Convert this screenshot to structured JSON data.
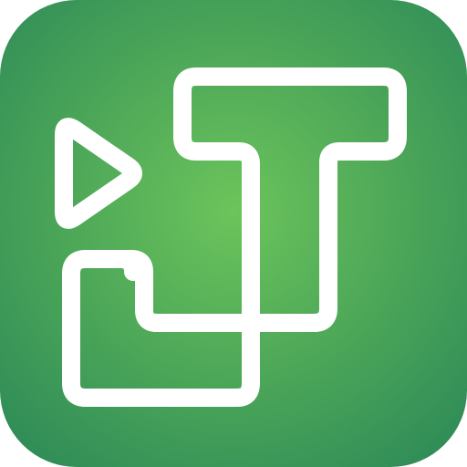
{
  "icon": {
    "name": "app-logo-icon",
    "glyphs": [
      "play-triangle-icon",
      "letter-j-icon",
      "letter-t-icon"
    ],
    "colors": {
      "background_center": "#6cc45a",
      "background_edge": "#2e8b57",
      "stroke": "#ffffff"
    }
  }
}
